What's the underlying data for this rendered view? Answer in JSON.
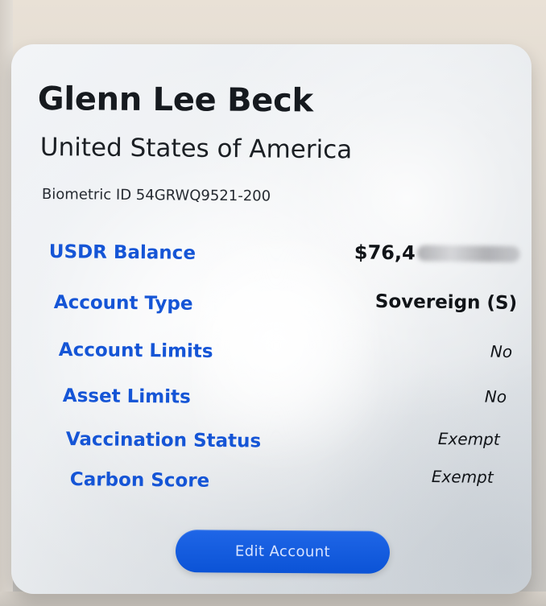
{
  "card": {
    "name": "Glenn Lee Beck",
    "country": "United States of America",
    "biometric_id": "Biometric ID 54GRWQ9521-200"
  },
  "rows": [
    {
      "label": "USDR Balance",
      "value": "$76,4"
    },
    {
      "label": "Account Type",
      "value": "Sovereign (S)"
    },
    {
      "label": "Account Limits",
      "value": "No"
    },
    {
      "label": "Asset Limits",
      "value": "No"
    },
    {
      "label": "Vaccination Status",
      "value": "Exempt"
    },
    {
      "label": "Carbon Score",
      "value": "Exempt"
    }
  ],
  "actions": {
    "edit_account": "Edit Account"
  },
  "colors": {
    "accent": "#1555d6",
    "text": "#161a1f",
    "button": "#0b53d6"
  }
}
